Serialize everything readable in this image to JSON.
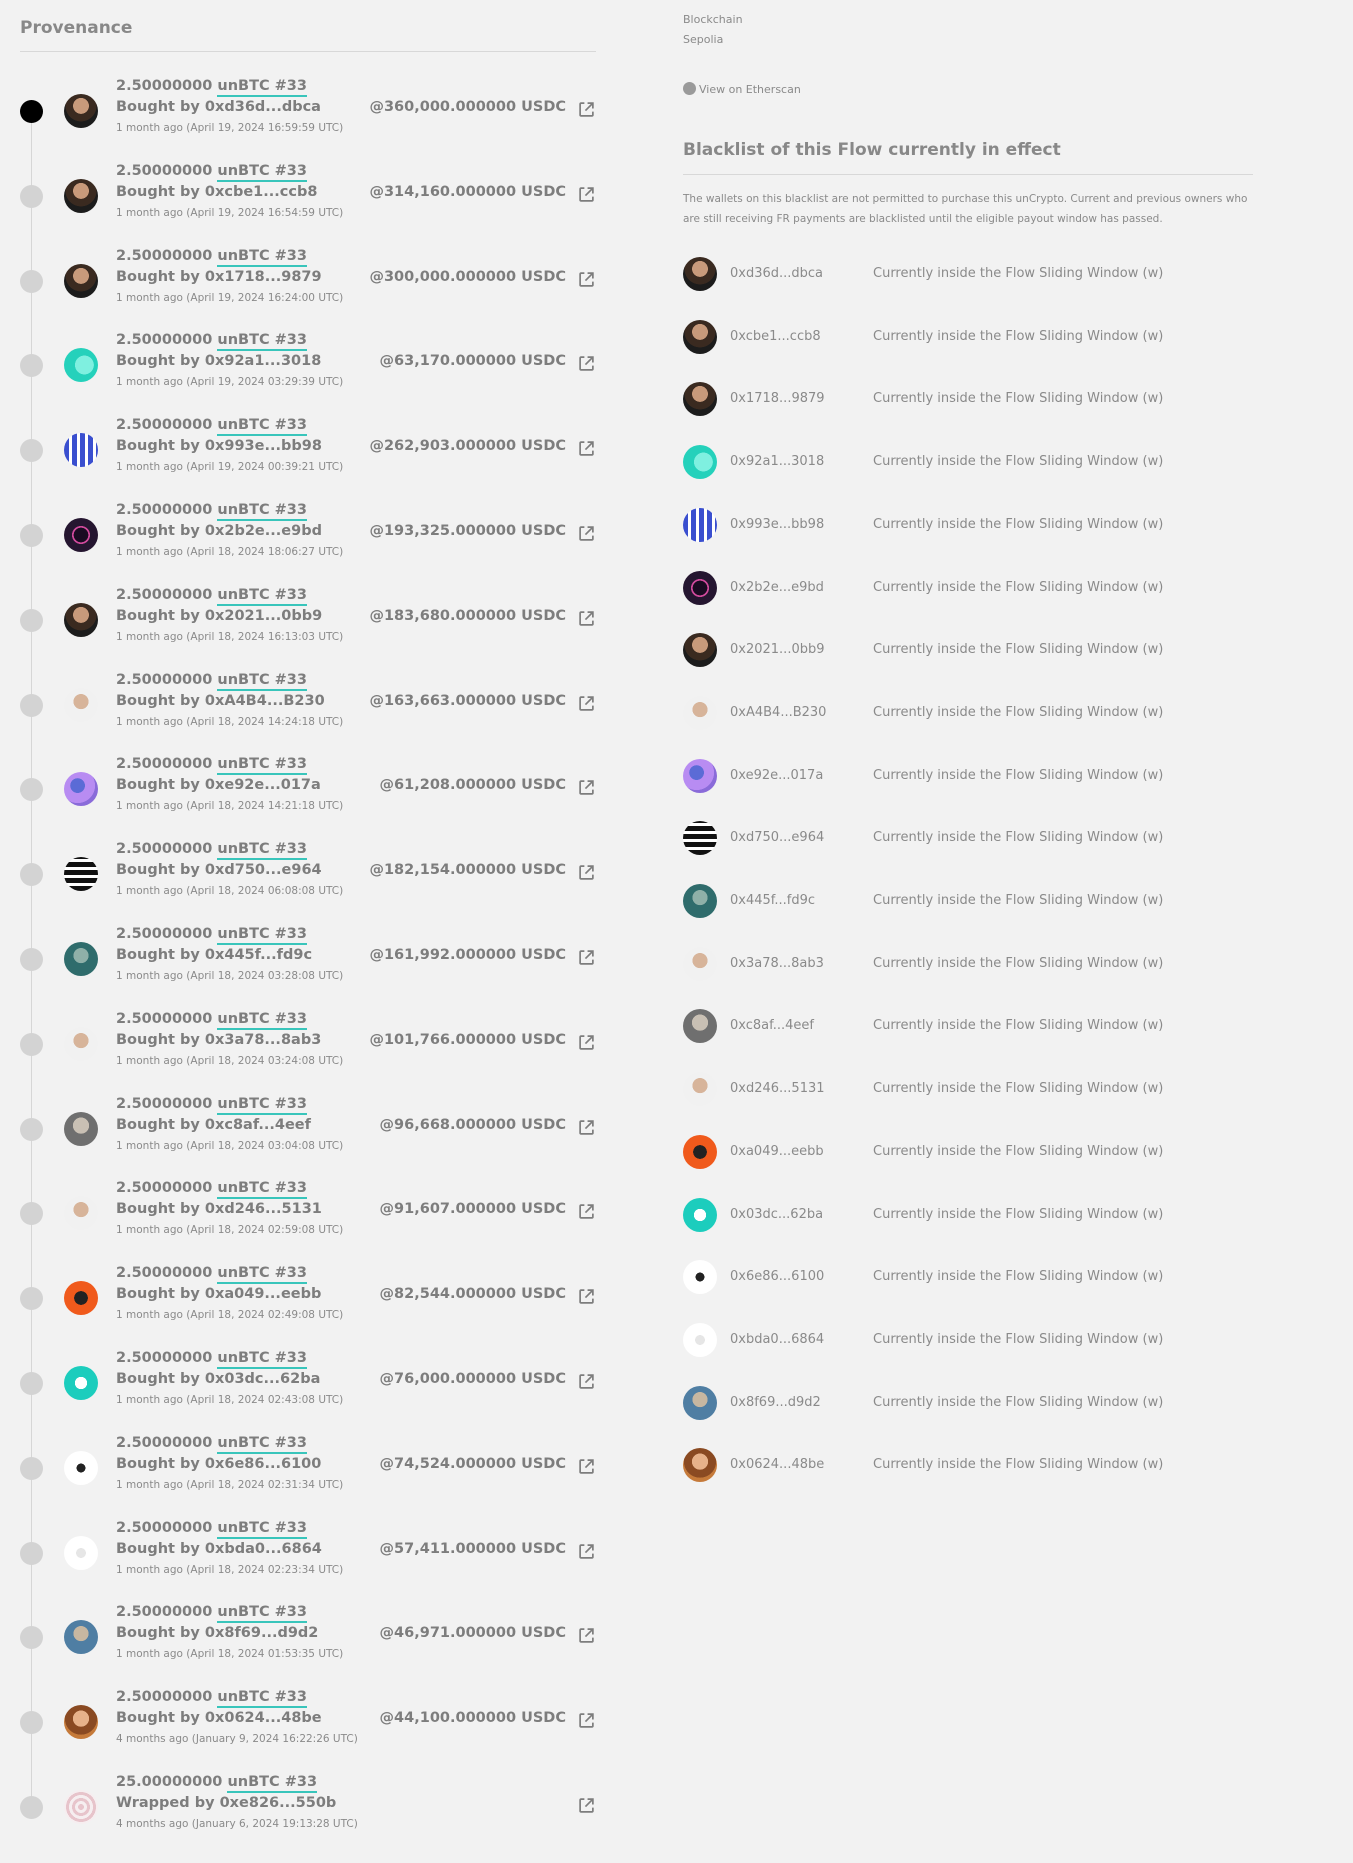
{
  "provenance": {
    "title": "Provenance",
    "items": [
      {
        "amount": "2.50000000",
        "token": "unBTC #33",
        "action": "Bought by",
        "addr": "0xd36d...dbca",
        "time": "1 month ago (April 19, 2024 16:59:59 UTC)",
        "price": "@360,000.000000 USDC",
        "avatar": "avatar-portrait"
      },
      {
        "amount": "2.50000000",
        "token": "unBTC #33",
        "action": "Bought by",
        "addr": "0xcbe1...ccb8",
        "time": "1 month ago (April 19, 2024 16:54:59 UTC)",
        "price": "@314,160.000000 USDC",
        "avatar": "avatar-portrait"
      },
      {
        "amount": "2.50000000",
        "token": "unBTC #33",
        "action": "Bought by",
        "addr": "0x1718...9879",
        "time": "1 month ago (April 19, 2024 16:24:00 UTC)",
        "price": "@300,000.000000 USDC",
        "avatar": "avatar-portrait"
      },
      {
        "amount": "2.50000000",
        "token": "unBTC #33",
        "action": "Bought by",
        "addr": "0x92a1...3018",
        "time": "1 month ago (April 19, 2024 03:29:39 UTC)",
        "price": "@63,170.000000 USDC",
        "avatar": "avatar-teal"
      },
      {
        "amount": "2.50000000",
        "token": "unBTC #33",
        "action": "Bought by",
        "addr": "0x993e...bb98",
        "time": "1 month ago (April 19, 2024 00:39:21 UTC)",
        "price": "@262,903.000000 USDC",
        "avatar": "avatar-pixel-blue"
      },
      {
        "amount": "2.50000000",
        "token": "unBTC #33",
        "action": "Bought by",
        "addr": "0x2b2e...e9bd",
        "time": "1 month ago (April 18, 2024 18:06:27 UTC)",
        "price": "@193,325.000000 USDC",
        "avatar": "avatar-dark-pink"
      },
      {
        "amount": "2.50000000",
        "token": "unBTC #33",
        "action": "Bought by",
        "addr": "0x2021...0bb9",
        "time": "1 month ago (April 18, 2024 16:13:03 UTC)",
        "price": "@183,680.000000 USDC",
        "avatar": "avatar-portrait"
      },
      {
        "amount": "2.50000000",
        "token": "unBTC #33",
        "action": "Bought by",
        "addr": "0xA4B4...B230",
        "time": "1 month ago (April 18, 2024 14:24:18 UTC)",
        "price": "@163,663.000000 USDC",
        "avatar": "avatar-light"
      },
      {
        "amount": "2.50000000",
        "token": "unBTC #33",
        "action": "Bought by",
        "addr": "0xe92e...017a",
        "time": "1 month ago (April 18, 2024 14:21:18 UTC)",
        "price": "@61,208.000000 USDC",
        "avatar": "avatar-purple"
      },
      {
        "amount": "2.50000000",
        "token": "unBTC #33",
        "action": "Bought by",
        "addr": "0xd750...e964",
        "time": "1 month ago (April 18, 2024 06:08:08 UTC)",
        "price": "@182,154.000000 USDC",
        "avatar": "avatar-pixel-black"
      },
      {
        "amount": "2.50000000",
        "token": "unBTC #33",
        "action": "Bought by",
        "addr": "0x445f...fd9c",
        "time": "1 month ago (April 18, 2024 03:28:08 UTC)",
        "price": "@161,992.000000 USDC",
        "avatar": "avatar-teal-dark"
      },
      {
        "amount": "2.50000000",
        "token": "unBTC #33",
        "action": "Bought by",
        "addr": "0x3a78...8ab3",
        "time": "1 month ago (April 18, 2024 03:24:08 UTC)",
        "price": "@101,766.000000 USDC",
        "avatar": "avatar-light"
      },
      {
        "amount": "2.50000000",
        "token": "unBTC #33",
        "action": "Bought by",
        "addr": "0xc8af...4eef",
        "time": "1 month ago (April 18, 2024 03:04:08 UTC)",
        "price": "@96,668.000000 USDC",
        "avatar": "avatar-grey"
      },
      {
        "amount": "2.50000000",
        "token": "unBTC #33",
        "action": "Bought by",
        "addr": "0xd246...5131",
        "time": "1 month ago (April 18, 2024 02:59:08 UTC)",
        "price": "@91,607.000000 USDC",
        "avatar": "avatar-light"
      },
      {
        "amount": "2.50000000",
        "token": "unBTC #33",
        "action": "Bought by",
        "addr": "0xa049...eebb",
        "time": "1 month ago (April 18, 2024 02:49:08 UTC)",
        "price": "@82,544.000000 USDC",
        "avatar": "avatar-orange"
      },
      {
        "amount": "2.50000000",
        "token": "unBTC #33",
        "action": "Bought by",
        "addr": "0x03dc...62ba",
        "time": "1 month ago (April 18, 2024 02:43:08 UTC)",
        "price": "@76,000.000000 USDC",
        "avatar": "avatar-cyan"
      },
      {
        "amount": "2.50000000",
        "token": "unBTC #33",
        "action": "Bought by",
        "addr": "0x6e86...6100",
        "time": "1 month ago (April 18, 2024 02:31:34 UTC)",
        "price": "@74,524.000000 USDC",
        "avatar": "avatar-calligraphy"
      },
      {
        "amount": "2.50000000",
        "token": "unBTC #33",
        "action": "Bought by",
        "addr": "0xbda0...6864",
        "time": "1 month ago (April 18, 2024 02:23:34 UTC)",
        "price": "@57,411.000000 USDC",
        "avatar": "avatar-white"
      },
      {
        "amount": "2.50000000",
        "token": "unBTC #33",
        "action": "Bought by",
        "addr": "0x8f69...d9d2",
        "time": "1 month ago (April 18, 2024 01:53:35 UTC)",
        "price": "@46,971.000000 USDC",
        "avatar": "avatar-blue-grey"
      },
      {
        "amount": "2.50000000",
        "token": "unBTC #33",
        "action": "Bought by",
        "addr": "0x0624...48be",
        "time": "4 months ago (January 9, 2024 16:22:26 UTC)",
        "price": "@44,100.000000 USDC",
        "avatar": "avatar-portrait-warm"
      },
      {
        "amount": "25.00000000",
        "token": "unBTC #33",
        "action": "Wrapped by",
        "addr": "0xe826...550b",
        "time": "4 months ago (January 6, 2024 19:13:28 UTC)",
        "price": "",
        "avatar": "avatar-pink-pattern"
      }
    ]
  },
  "chain": {
    "label": "Blockchain",
    "value": "Sepolia",
    "etherscan": "View on Etherscan"
  },
  "blacklist": {
    "title": "Blacklist of this Flow currently in effect",
    "description": "The wallets on this blacklist are not permitted to purchase this unCrypto. Current and previous owners who are still receiving FR payments are blacklisted until the eligible payout window has passed.",
    "rows": [
      {
        "addr": "0xd36d...dbca",
        "status": "Currently inside the Flow Sliding Window (w)",
        "avatar": "avatar-portrait"
      },
      {
        "addr": "0xcbe1...ccb8",
        "status": "Currently inside the Flow Sliding Window (w)",
        "avatar": "avatar-portrait"
      },
      {
        "addr": "0x1718...9879",
        "status": "Currently inside the Flow Sliding Window (w)",
        "avatar": "avatar-portrait"
      },
      {
        "addr": "0x92a1...3018",
        "status": "Currently inside the Flow Sliding Window (w)",
        "avatar": "avatar-teal"
      },
      {
        "addr": "0x993e...bb98",
        "status": "Currently inside the Flow Sliding Window (w)",
        "avatar": "avatar-pixel-blue"
      },
      {
        "addr": "0x2b2e...e9bd",
        "status": "Currently inside the Flow Sliding Window (w)",
        "avatar": "avatar-dark-pink"
      },
      {
        "addr": "0x2021...0bb9",
        "status": "Currently inside the Flow Sliding Window (w)",
        "avatar": "avatar-portrait"
      },
      {
        "addr": "0xA4B4...B230",
        "status": "Currently inside the Flow Sliding Window (w)",
        "avatar": "avatar-light"
      },
      {
        "addr": "0xe92e...017a",
        "status": "Currently inside the Flow Sliding Window (w)",
        "avatar": "avatar-purple"
      },
      {
        "addr": "0xd750...e964",
        "status": "Currently inside the Flow Sliding Window (w)",
        "avatar": "avatar-pixel-black"
      },
      {
        "addr": "0x445f...fd9c",
        "status": "Currently inside the Flow Sliding Window (w)",
        "avatar": "avatar-teal-dark"
      },
      {
        "addr": "0x3a78...8ab3",
        "status": "Currently inside the Flow Sliding Window (w)",
        "avatar": "avatar-light"
      },
      {
        "addr": "0xc8af...4eef",
        "status": "Currently inside the Flow Sliding Window (w)",
        "avatar": "avatar-grey"
      },
      {
        "addr": "0xd246...5131",
        "status": "Currently inside the Flow Sliding Window (w)",
        "avatar": "avatar-light"
      },
      {
        "addr": "0xa049...eebb",
        "status": "Currently inside the Flow Sliding Window (w)",
        "avatar": "avatar-orange"
      },
      {
        "addr": "0x03dc...62ba",
        "status": "Currently inside the Flow Sliding Window (w)",
        "avatar": "avatar-cyan"
      },
      {
        "addr": "0x6e86...6100",
        "status": "Currently inside the Flow Sliding Window (w)",
        "avatar": "avatar-calligraphy"
      },
      {
        "addr": "0xbda0...6864",
        "status": "Currently inside the Flow Sliding Window (w)",
        "avatar": "avatar-white"
      },
      {
        "addr": "0x8f69...d9d2",
        "status": "Currently inside the Flow Sliding Window (w)",
        "avatar": "avatar-blue-grey"
      },
      {
        "addr": "0x0624...48be",
        "status": "Currently inside the Flow Sliding Window (w)",
        "avatar": "avatar-portrait-warm"
      }
    ]
  },
  "colors": {
    "accent": "#39c5bb",
    "text": "#7d7d7d",
    "muted": "#8a8a8a",
    "dot": "#d3d3d3",
    "dot_active": "#000000"
  }
}
